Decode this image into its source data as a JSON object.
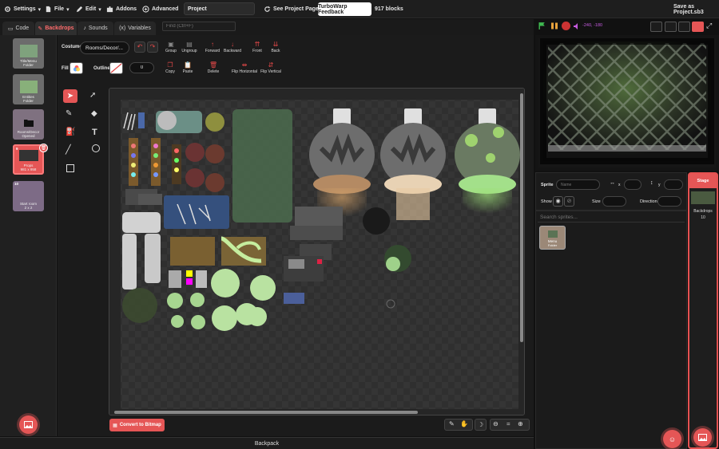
{
  "menubar": {
    "settings": "Settings",
    "file": "File",
    "edit": "Edit",
    "addons": "Addons",
    "advanced": "Advanced",
    "project_title": "Project",
    "see_project_page": "See Project Page",
    "feedback": "TurboWarp Feedback",
    "blocks_count": "917 blocks",
    "save_as": "Save as Project.sb3"
  },
  "tabs": {
    "code": "Code",
    "backdrops": "Backdrops",
    "sounds": "Sounds",
    "variables": "Variables",
    "find_placeholder": "Find (Ctrl+F)"
  },
  "controls": {
    "mouse_coords": "-240, -180"
  },
  "costumes": [
    {
      "num": "",
      "name": "Title/Menu",
      "sub": "Folder"
    },
    {
      "num": "",
      "name": "Entities",
      "sub": "Folder"
    },
    {
      "num": "",
      "name": "Rooms/Decor",
      "sub": "Opened"
    },
    {
      "num": "9",
      "name": "Props",
      "sub": "981 x 958"
    },
    {
      "num": "10",
      "name": "Start room",
      "sub": "2 x 2"
    }
  ],
  "paint": {
    "costume_label": "Costume",
    "costume_name": "Rooms/Decor/...",
    "fill_label": "Fill",
    "outline_label": "Outline",
    "outline_width": "0",
    "group": "Group",
    "ungroup": "Ungroup",
    "forward": "Forward",
    "backward": "Backward",
    "front": "Front",
    "back": "Back",
    "copy": "Copy",
    "paste": "Paste",
    "delete": "Delete",
    "flip_h": "Flip Horizontal",
    "flip_v": "Flip Vertical",
    "convert": "Convert to Bitmap",
    "zoom_reset": "="
  },
  "sprite_info": {
    "sprite_label": "Sprite",
    "name_placeholder": "Name",
    "x_label": "x",
    "y_label": "y",
    "show_label": "Show",
    "size_label": "Size",
    "direction_label": "Direction",
    "search_placeholder": "Search sprites..."
  },
  "sprites": [
    {
      "name": "Menu",
      "sub": "Folder"
    }
  ],
  "stage": {
    "title": "Stage",
    "backdrops_label": "Backdrops",
    "backdrops_count": "10"
  },
  "backpack": "Backpack",
  "colors": {
    "accent": "#e55656",
    "panel": "#1b1b1b",
    "menubar": "#1e1e1e"
  }
}
